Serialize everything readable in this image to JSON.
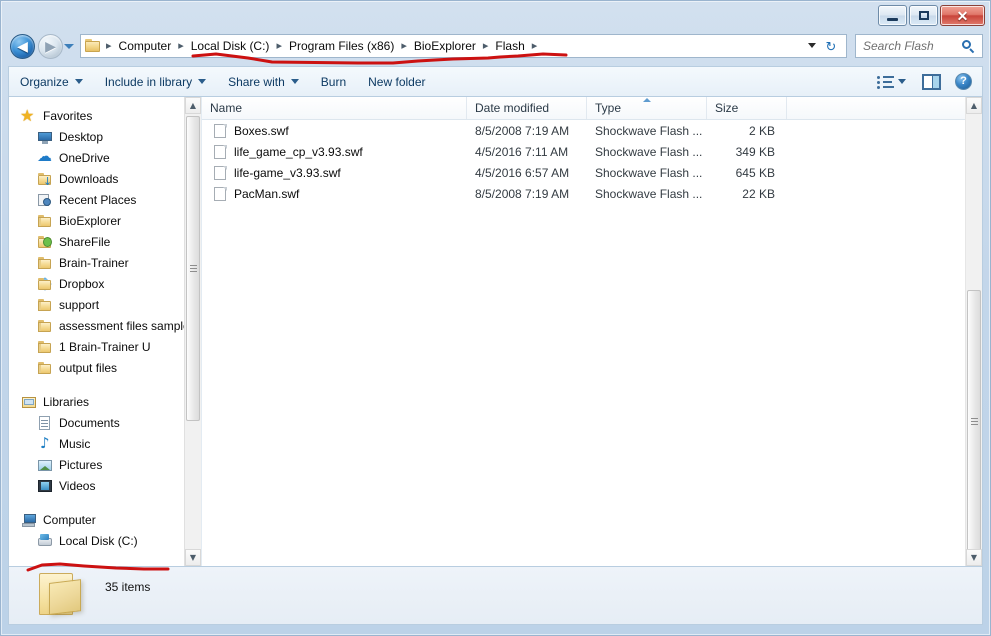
{
  "window": {
    "caption_buttons": {
      "minimize_label": "–",
      "maximize_label": "□",
      "close_label": "✕"
    }
  },
  "address_bar": {
    "back_label": "◀",
    "forward_label": "▶",
    "separator": "▸",
    "breadcrumbs": [
      "Computer",
      "Local Disk (C:)",
      "Program Files (x86)",
      "BioExplorer",
      "Flash"
    ],
    "refresh_label": "↻",
    "search_placeholder": "Search Flash"
  },
  "toolbar": {
    "items": [
      {
        "label": "Organize",
        "has_caret": true
      },
      {
        "label": "Include in library",
        "has_caret": true
      },
      {
        "label": "Share with",
        "has_caret": true
      },
      {
        "label": "Burn",
        "has_caret": false
      },
      {
        "label": "New folder",
        "has_caret": false
      }
    ],
    "help_label": "?"
  },
  "sidebar": {
    "groups": [
      {
        "name": "Favorites",
        "icon": "star-icon",
        "items": [
          {
            "label": "Desktop",
            "icon": "monitor-icon"
          },
          {
            "label": "OneDrive",
            "icon": "cloud-icon"
          },
          {
            "label": "Downloads",
            "icon": "folder-download-icon"
          },
          {
            "label": "Recent Places",
            "icon": "recent-places-icon"
          },
          {
            "label": "BioExplorer",
            "icon": "folder-icon"
          },
          {
            "label": "ShareFile",
            "icon": "sharefile-icon"
          },
          {
            "label": "Brain-Trainer",
            "icon": "folder-icon"
          },
          {
            "label": "Dropbox",
            "icon": "dropbox-icon"
          },
          {
            "label": "support",
            "icon": "folder-icon"
          },
          {
            "label": "assessment files sample",
            "icon": "folder-icon"
          },
          {
            "label": "1 Brain-Trainer U",
            "icon": "folder-icon"
          },
          {
            "label": "output files",
            "icon": "folder-icon"
          }
        ]
      },
      {
        "name": "Libraries",
        "icon": "libraries-icon",
        "items": [
          {
            "label": "Documents",
            "icon": "document-icon"
          },
          {
            "label": "Music",
            "icon": "music-icon"
          },
          {
            "label": "Pictures",
            "icon": "pictures-icon"
          },
          {
            "label": "Videos",
            "icon": "videos-icon"
          }
        ]
      },
      {
        "name": "Computer",
        "icon": "computer-icon",
        "items": [
          {
            "label": "Local Disk (C:)",
            "icon": "drive-icon"
          }
        ]
      }
    ]
  },
  "file_list": {
    "columns": [
      {
        "label": "Name",
        "sorted": false
      },
      {
        "label": "Date modified",
        "sorted": false
      },
      {
        "label": "Type",
        "sorted": true
      },
      {
        "label": "Size",
        "sorted": false
      }
    ],
    "rows": [
      {
        "name": "Boxes.swf",
        "date_modified": "8/5/2008 7:19 AM",
        "type": "Shockwave Flash ...",
        "size": "2 KB"
      },
      {
        "name": "life_game_cp_v3.93.swf",
        "date_modified": "4/5/2016 7:11 AM",
        "type": "Shockwave Flash ...",
        "size": "349 KB"
      },
      {
        "name": "life-game_v3.93.swf",
        "date_modified": "4/5/2016 6:57 AM",
        "type": "Shockwave Flash ...",
        "size": "645 KB"
      },
      {
        "name": "PacMan.swf",
        "date_modified": "8/5/2008 7:19 AM",
        "type": "Shockwave Flash ...",
        "size": "22 KB"
      }
    ]
  },
  "status_bar": {
    "item_count": "35 items"
  },
  "scrollbars": {
    "up_arrow": "▲",
    "down_arrow": "▼"
  },
  "colors": {
    "accent_blue": "#2a6fb0",
    "annotation_red": "#cc1111",
    "folder_yellow": "#f5dc96"
  }
}
